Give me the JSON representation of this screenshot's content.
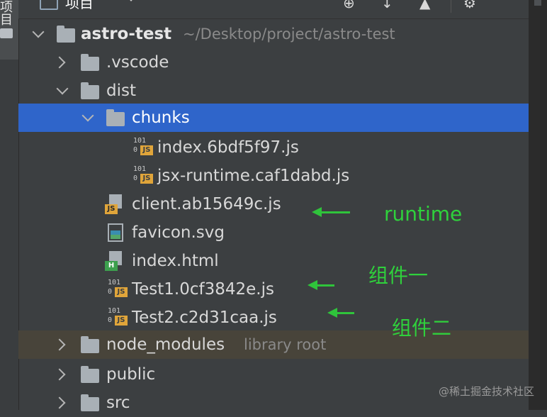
{
  "left_strip": {
    "label": "项目"
  },
  "toolbar": {
    "title": "项目",
    "buttons": [
      "globe-icon",
      "collapse-icon",
      "expand-icon",
      "gear-icon"
    ]
  },
  "tree": {
    "root": {
      "name": "astro-test",
      "path": "~/Desktop/project/astro-test"
    },
    "vscode": {
      "name": ".vscode"
    },
    "dist": {
      "name": "dist"
    },
    "chunks": {
      "name": "chunks"
    },
    "chunk_file_1": {
      "name": "index.6bdf5f97.js",
      "icon_text": "101\n0",
      "type": "JS"
    },
    "chunk_file_2": {
      "name": "jsx-runtime.caf1dabd.js",
      "icon_text": "101\n0",
      "type": "JS"
    },
    "client": {
      "name": "client.ab15649c.js",
      "type": "JS"
    },
    "favicon": {
      "name": "favicon.svg"
    },
    "index_html": {
      "name": "index.html",
      "type": "H"
    },
    "test1": {
      "name": "Test1.0cf3842e.js",
      "type": "JS"
    },
    "test2": {
      "name": "Test2.c2d31caa.js",
      "type": "JS"
    },
    "node_modules": {
      "name": "node_modules",
      "hint": "library root"
    },
    "public": {
      "name": "public"
    },
    "src": {
      "name": "src"
    }
  },
  "icon_bits": {
    "top": "101",
    "bottom": "0"
  },
  "annotations": {
    "runtime": "runtime",
    "component1": "组件一",
    "component2": "组件二"
  },
  "watermark": "@稀土掘金技术社区",
  "colors": {
    "selection": "#2f65ca",
    "annotation_green": "#2fd13c",
    "js_badge": "#e0a53a",
    "html_badge": "#3da04e"
  }
}
